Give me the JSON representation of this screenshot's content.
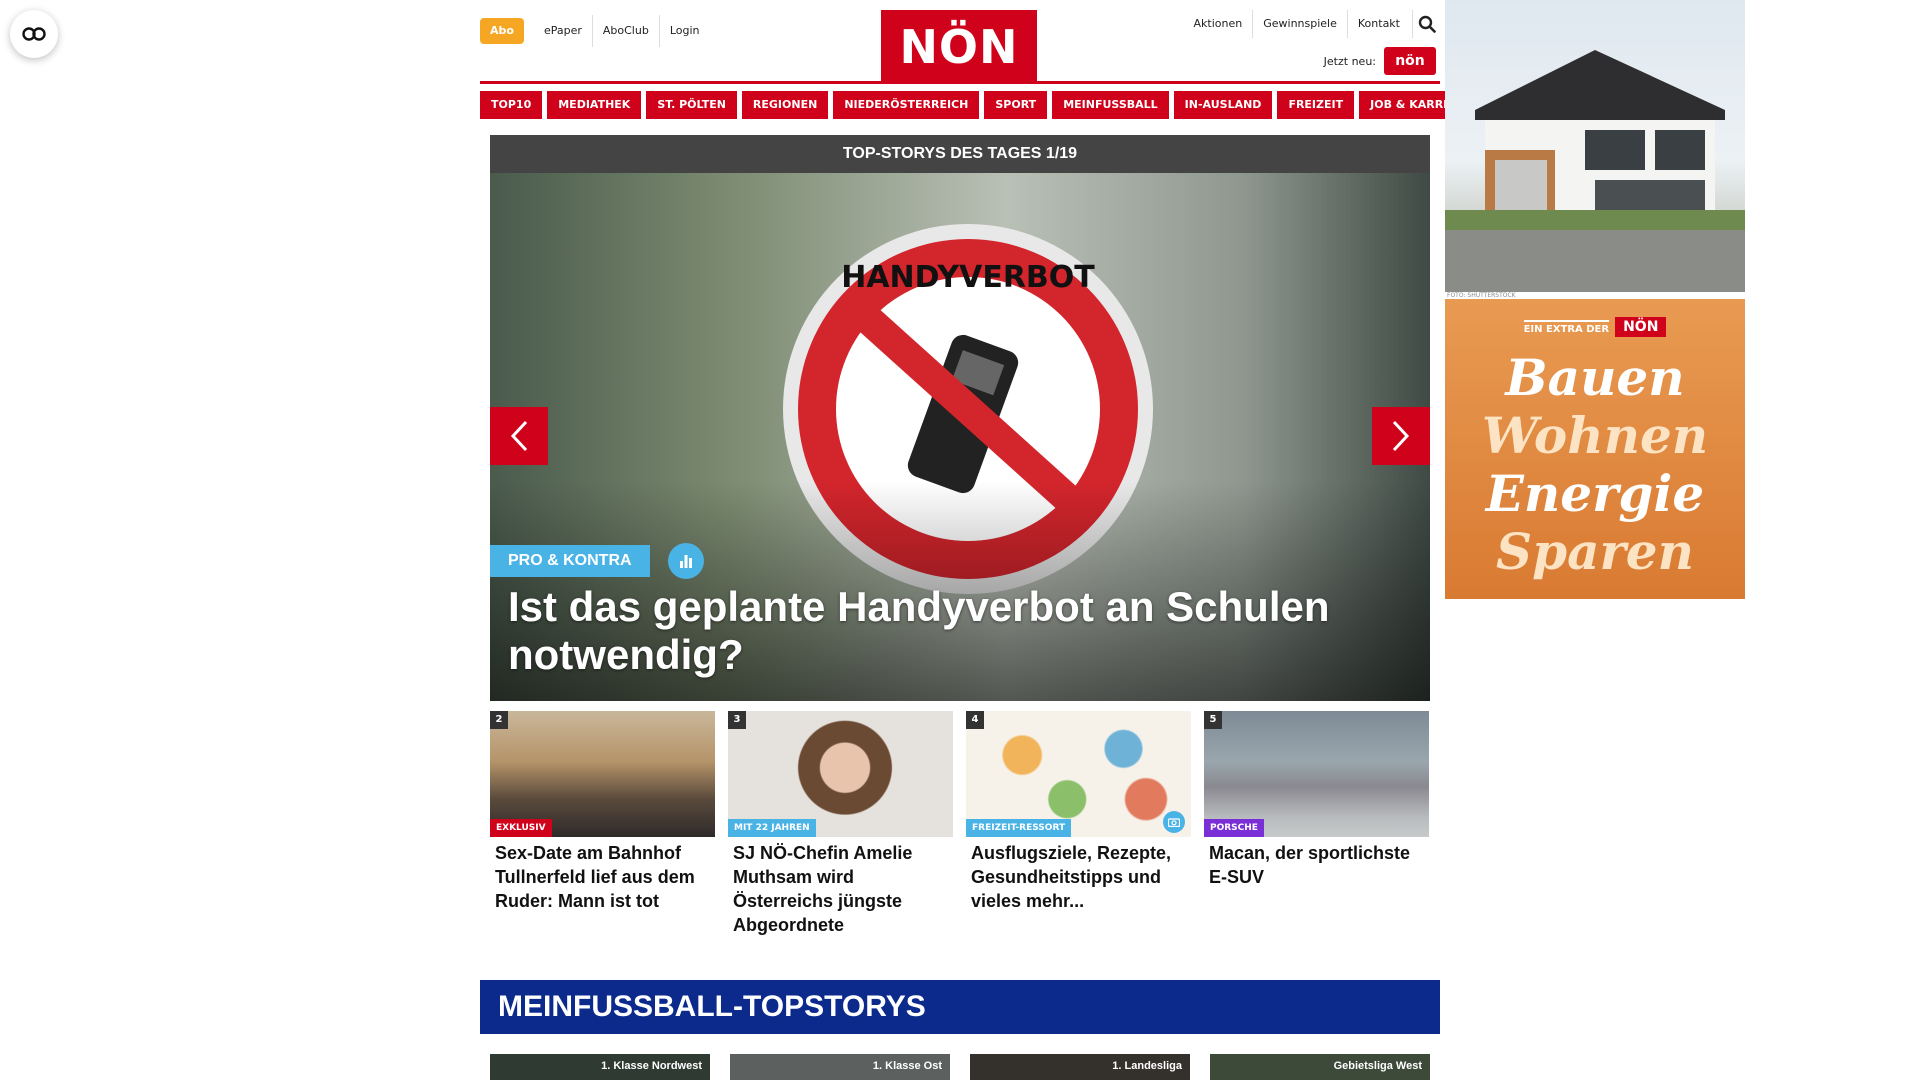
{
  "header": {
    "abo_label": "Abo",
    "left_links": [
      "ePaper",
      "AboClub",
      "Login"
    ],
    "logo_text": "NÖN",
    "right_links": [
      "Aktionen",
      "Gewinnspiele",
      "Kontakt"
    ],
    "jetzt_label": "Jetzt neu:",
    "mini_logo_text": "nön"
  },
  "nav": [
    "TOP10",
    "MEDIATHEK",
    "ST. PÖLTEN",
    "REGIONEN",
    "NIEDERÖSTERREICH",
    "SPORT",
    "MEINFUSSBALL",
    "IN-AUSLAND",
    "FREIZEIT",
    "JOB & KARRIERE"
  ],
  "hero": {
    "bar_title": "TOP-STORYS DES TAGES 1/19",
    "sign_text": "HANDYVERBOT",
    "tag": "PRO & KONTRA",
    "title": "Ist das geplante Handyverbot an Schulen notwendig?"
  },
  "teasers": [
    {
      "num": "2",
      "tag": "EXKLUSIV",
      "tag_color": "#d0021b",
      "title": "Sex-Date am Bahnhof Tullnerfeld lief aus dem Ruder: Mann ist tot"
    },
    {
      "num": "3",
      "tag": "MIT 22 JAHREN",
      "tag_color": "#4ab3e6",
      "title": "SJ NÖ-Chefin Amelie Muthsam wird Österreichs jüngste Abgeordnete"
    },
    {
      "num": "4",
      "tag": "FREIZEIT-RESSORT",
      "tag_color": "#4ab3e6",
      "title": "Ausflugsziele, Rezepte, Gesundheitstipps und vieles mehr..."
    },
    {
      "num": "5",
      "tag": "PORSCHE",
      "tag_color": "#7a2fd6",
      "title": "Macan, der sportlichste E-SUV"
    }
  ],
  "football": {
    "section_title": "MEINFUSSBALL-TOPSTORYS",
    "leagues": [
      "1. Klasse Nordwest",
      "1. Klasse Ost",
      "1. Landesliga",
      "Gebietsliga West"
    ]
  },
  "ads": {
    "house_caption": "FOTO: SHUTTERSTOCK",
    "bauen_extra": "EIN EXTRA DER",
    "bauen_logo": "NÖN",
    "bauen_words": [
      "Bauen",
      "Wohnen",
      "Energie",
      "Sparen"
    ]
  },
  "colors": {
    "brand_red": "#d0021b",
    "abo_orange": "#f5a623",
    "tag_blue": "#4ab3e6",
    "football_navy": "#0b2a8c"
  },
  "icons": [
    "accessibility-glasses-icon",
    "search-icon",
    "chevron-left-icon",
    "chevron-right-icon",
    "poll-chart-icon",
    "camera-icon"
  ]
}
